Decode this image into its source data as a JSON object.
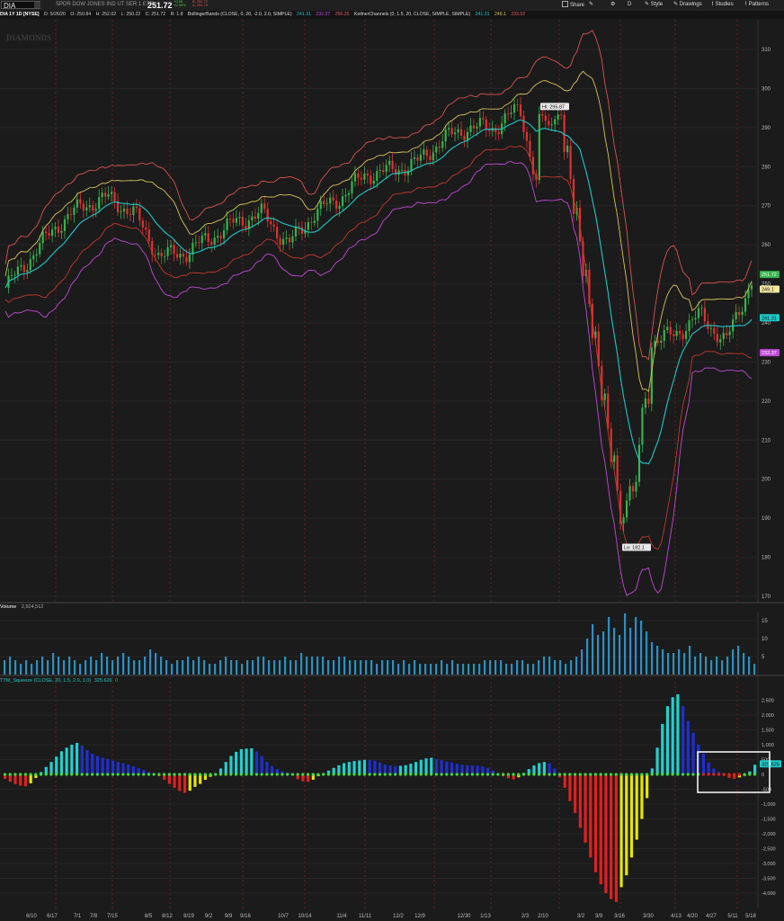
{
  "header": {
    "symbol": "DIA",
    "description": "SPDR DOW JONES IND UT SER 1 ETF",
    "last": "251.72",
    "change": "+0.98",
    "change_pct": "+0.39%",
    "bid": "B: 251.72",
    "ask": "A: 251.79",
    "toolbar": {
      "share": "Share",
      "style": "Style",
      "drawings": "Drawings",
      "studies": "Studies",
      "patterns": "Patterns",
      "d_label": "D"
    }
  },
  "studybar": {
    "title": "DIA 1Y 1D [NYSE]",
    "ohlc": [
      "D: 5/26/20",
      "O: 250.84",
      "H: 252.02",
      "L: 250.22",
      "C: 251.72",
      "R: 1.8"
    ],
    "bb_label": "BollingerBands (CLOSE, 0, 20, -2.0, 2.0, SIMPLE)",
    "bb_values": [
      "241.31",
      "232.37",
      "250.25"
    ],
    "kc_label": "KeltnerChannels (0, 1.5, 20, CLOSE, SIMPLE, SIMPLE)",
    "kc_values": [
      "241.31",
      "249.1",
      "233.52"
    ]
  },
  "watermark": "DIAMONDS",
  "volume": {
    "label": "Volume",
    "value": "2,924,512"
  },
  "squeeze": {
    "label": "TTM_Squeeze (CLOSE, 20, 1.5, 2.0, 1.0)",
    "value": "325.626",
    "flag": "0"
  },
  "price_badges": [
    "251.72",
    "249.1",
    "241.31",
    "232.37"
  ],
  "annotations": {
    "hi": "Hi: 295.87",
    "lo": "Lo: 182.1"
  },
  "colors": {
    "bg": "#1b1b1b",
    "up": "#37b24d",
    "down": "#e03131",
    "bb_mid": "#1ec8c8",
    "kc_up": "#d9c35a",
    "bb_up": "#d9534f",
    "kc_lo": "#c04ad6",
    "vol": "#2e8fbf"
  },
  "chart_data": [
    {
      "type": "line",
      "title": "DIA 1Y 1D [NYSE]",
      "x": [
        "6/10",
        "6/17",
        "7/1",
        "7/8",
        "7/15",
        "8/5",
        "8/12",
        "8/19",
        "9/2",
        "9/9",
        "9/16",
        "10/7",
        "10/14",
        "11/4",
        "11/11",
        "12/2",
        "12/9",
        "12/30",
        "1/13",
        "2/3",
        "2/10",
        "3/2",
        "3/9",
        "3/16",
        "3/30",
        "4/13",
        "4/20",
        "4/27",
        "5/11",
        "5/18"
      ],
      "series": [
        {
          "name": "close",
          "values": [
            249,
            257,
            265,
            270,
            272,
            268,
            257,
            258,
            262,
            266,
            268,
            260,
            268,
            272,
            278,
            279,
            281,
            287,
            290,
            290,
            295,
            265,
            255,
            225,
            216,
            235,
            237,
            242,
            235,
            251
          ]
        }
      ],
      "ylim": [
        170,
        315
      ],
      "yticks": [
        170,
        180,
        190,
        200,
        210,
        220,
        230,
        240,
        250,
        260,
        270,
        280,
        290,
        300,
        310
      ],
      "hi": 295.87,
      "lo": 182.1
    },
    {
      "type": "bar",
      "title": "Volume",
      "ylim": [
        0,
        17
      ],
      "yticks": [
        5,
        10,
        15
      ],
      "values": [
        4,
        5,
        4,
        3,
        4,
        3,
        4,
        5,
        4,
        6,
        5,
        4,
        5,
        4,
        3,
        4,
        5,
        4,
        6,
        5,
        4,
        5,
        6,
        5,
        4,
        4,
        5,
        7,
        6,
        5,
        4,
        3,
        4,
        4,
        5,
        4,
        5,
        4,
        3,
        3,
        4,
        5,
        4,
        4,
        3,
        4,
        4,
        5,
        5,
        4,
        4,
        4,
        5,
        4,
        4,
        6,
        5,
        5,
        5,
        5,
        4,
        4,
        5,
        5,
        4,
        4,
        4,
        4,
        4,
        3,
        4,
        4,
        4,
        3,
        4,
        3,
        4,
        3,
        3,
        3,
        3,
        4,
        3,
        4,
        3,
        3,
        3,
        3,
        3,
        4,
        4,
        4,
        4,
        3,
        3,
        4,
        4,
        3,
        3,
        4,
        5,
        5,
        4,
        4,
        3,
        4,
        5,
        7,
        10,
        14,
        11,
        12,
        16,
        13,
        11,
        17,
        13,
        16,
        15,
        12,
        9,
        8,
        7,
        6,
        6,
        7,
        6,
        8,
        5,
        6,
        5,
        4,
        5,
        4,
        5,
        7,
        8,
        6,
        5,
        3
      ]
    },
    {
      "type": "bar",
      "title": "TTM_Squeeze",
      "ylim": [
        -4500,
        3000
      ],
      "yticks": [
        2500,
        2000,
        1500,
        1000,
        500,
        0,
        -500,
        -1000,
        -1500,
        -2000,
        -2500,
        -3000,
        -3500,
        -4000
      ],
      "values": [
        -150,
        -250,
        -330,
        -380,
        -400,
        -300,
        -120,
        80,
        250,
        420,
        600,
        780,
        900,
        1000,
        1060,
        970,
        820,
        700,
        620,
        560,
        520,
        470,
        420,
        380,
        330,
        280,
        210,
        150,
        80,
        40,
        -60,
        -180,
        -320,
        -450,
        -560,
        -620,
        -550,
        -420,
        -320,
        -180,
        -80,
        10,
        200,
        420,
        620,
        760,
        850,
        870,
        880,
        770,
        620,
        420,
        280,
        180,
        100,
        60,
        -40,
        -160,
        -230,
        -250,
        -180,
        -60,
        40,
        130,
        220,
        310,
        380,
        420,
        450,
        470,
        490,
        480,
        460,
        400,
        330,
        300,
        280,
        290,
        310,
        360,
        420,
        490,
        540,
        560,
        520,
        480,
        430,
        400,
        360,
        330,
        310,
        300,
        290,
        270,
        220,
        130,
        40,
        -60,
        -130,
        -170,
        -100,
        50,
        180,
        300,
        380,
        420,
        380,
        200,
        -100,
        -450,
        -900,
        -1300,
        -1800,
        -2300,
        -2800,
        -3300,
        -3700,
        -4000,
        -4200,
        -4300,
        -3800,
        -3400,
        -2800,
        -2200,
        -1500,
        -800,
        200,
        900,
        1700,
        2300,
        2600,
        2700,
        2300,
        1800,
        1400,
        1000,
        700,
        400,
        200,
        80,
        -50,
        -120,
        -150,
        -100,
        -50,
        100,
        325.6
      ]
    }
  ],
  "price_axis_labels": [
    "310",
    "300",
    "290",
    "280",
    "270",
    "260",
    "250",
    "240",
    "230",
    "220",
    "210",
    "200",
    "190",
    "180",
    "170"
  ],
  "vol_axis_labels": [
    "15",
    "10",
    "5"
  ],
  "sq_axis_labels": [
    "2,500",
    "2,000",
    "1,500",
    "1,000",
    "500",
    "0",
    "-500",
    "-1,000",
    "-1,500",
    "-2,000",
    "-2,500",
    "-3,000",
    "-3,500",
    "-4,000"
  ],
  "date_labels": [
    "6/10",
    "6/17",
    "7/1",
    "7/8",
    "7/15",
    "8/5",
    "8/12",
    "8/19",
    "9/2",
    "9/9",
    "9/16",
    "10/7",
    "10/14",
    "11/4",
    "11/11",
    "12/2",
    "12/9",
    "12/30",
    "1/13",
    "2/3",
    "2/10",
    "3/2",
    "3/9",
    "3/16",
    "3/30",
    "4/13",
    "4/20",
    "4/27",
    "5/11",
    "5/18"
  ]
}
